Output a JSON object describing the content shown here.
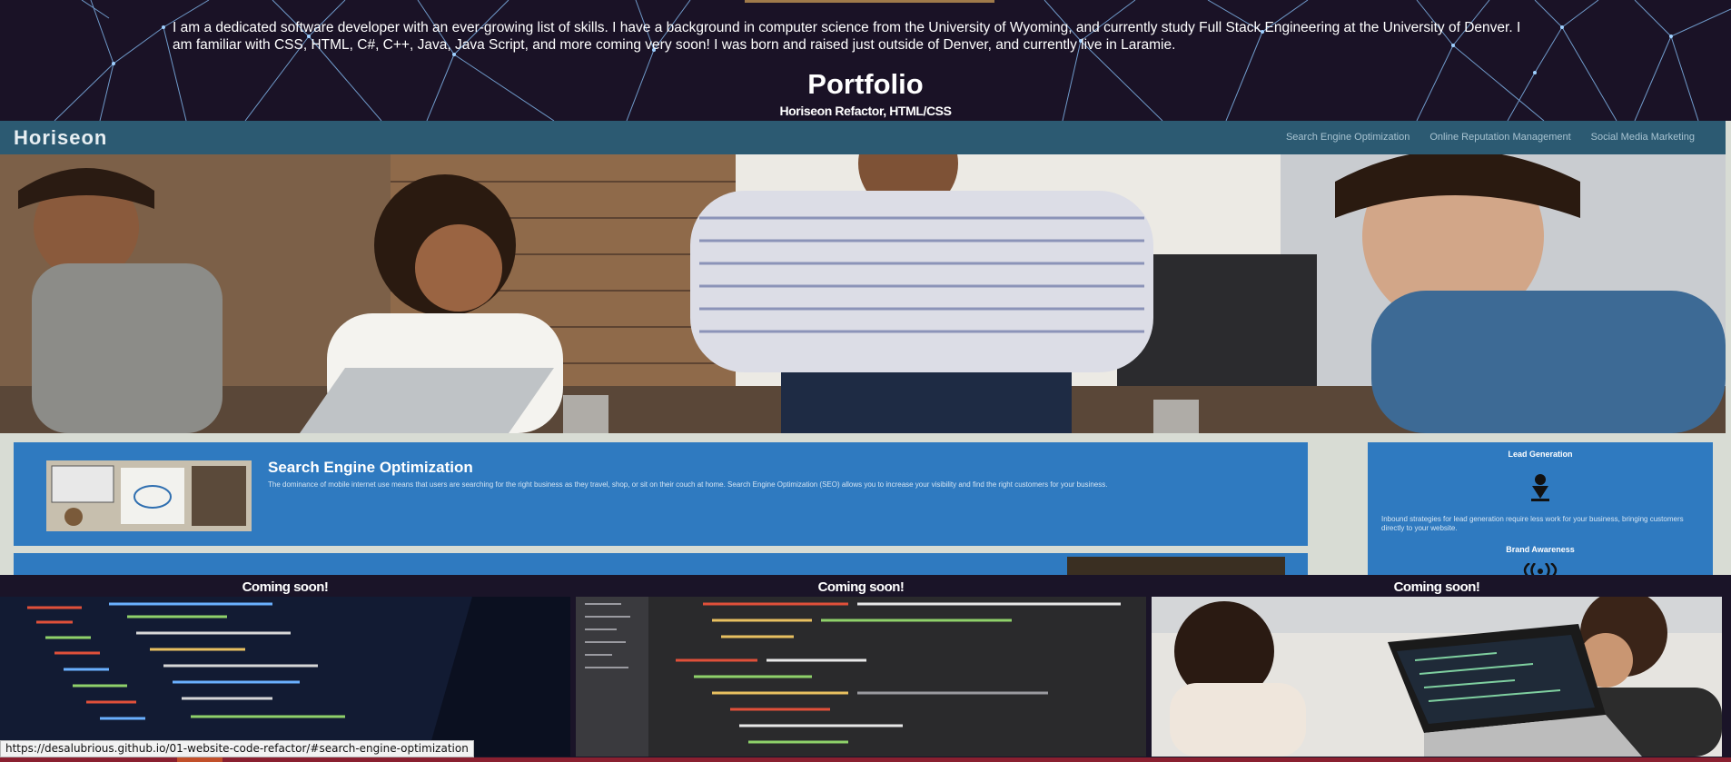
{
  "portfolio": {
    "bio": "I am a dedicated software developer with an ever-growing list of skills. I have a background in computer science from the University of Wyoming, and currently study Full Stack Engineering at the University of Denver. I am familiar with CSS, HTML, C#, C++, Java, Java Script, and more coming very soon! I was born and raised just outside of Denver, and currently live in Laramie.",
    "title": "Portfolio",
    "project_caption": "Horiseon Refactor, HTML/CSS"
  },
  "preview": {
    "logo": "Horiseon",
    "nav": [
      "Search Engine Optimization",
      "Online Reputation Management",
      "Social Media Marketing"
    ],
    "seo_title": "Search Engine Optimization",
    "seo_text": "The dominance of mobile internet use means that users are searching for the right business as they travel, shop, or sit on their couch at home. Search Engine Optimization (SEO) allows you to increase your visibility and find the right customers for your business.",
    "sidebar_heading_1": "Lead Generation",
    "sidebar_text_1": "Inbound strategies for lead generation require less work for your business, bringing customers directly to your website.",
    "sidebar_heading_2": "Brand Awareness"
  },
  "cards": [
    {
      "caption": "Coming soon!",
      "image": "code-on-laptop"
    },
    {
      "caption": "Coming soon!",
      "image": "code-editor"
    },
    {
      "caption": "Coming soon!",
      "image": "people-at-laptop"
    }
  ],
  "status_url": "https://desalubrious.github.io/01-website-code-refactor/#search-engine-optimization",
  "colors": {
    "header_bg": "#1a1226",
    "network_lines": "#7fb3e8",
    "preview_nav": "#2c5a72",
    "preview_blue": "#2f7ac0"
  }
}
